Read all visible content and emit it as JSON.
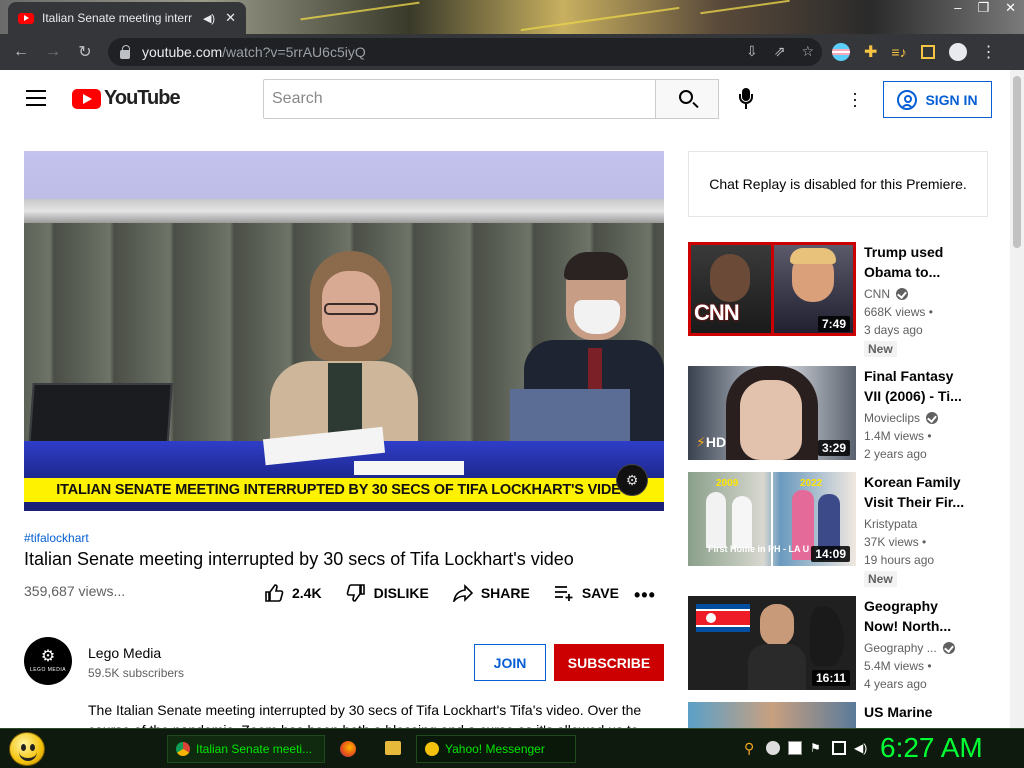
{
  "browser": {
    "tab_title": "Italian Senate meeting interr",
    "url_domain": "youtube.com",
    "url_path": "/watch?v=5rrAU6c5iyQ"
  },
  "masthead": {
    "logo_text": "YouTube",
    "search_placeholder": "Search",
    "signin_label": "SIGN IN"
  },
  "video": {
    "caption": "ITALIAN SENATE MEETING INTERRUPTED BY 30 SECS OF TIFA LOCKHART'S VIDEO",
    "hashtag": "#tifalockhart",
    "title": "Italian Senate meeting interrupted by 30 secs of Tifa Lockhart's video",
    "views": "359,687 views...",
    "actions": {
      "like_count": "2.4K",
      "dislike_label": "DISLIKE",
      "share_label": "SHARE",
      "save_label": "SAVE"
    },
    "channel": {
      "name": "Lego Media",
      "subscribers": "59.5K subscribers",
      "avatar_text": "LEGO MEDIA",
      "join_label": "JOIN",
      "subscribe_label": "SUBSCRIBE"
    },
    "description": "The Italian Senate meeting interrupted by 30 secs of Tifa Lockhart's Tifa's video. Over the course of the pandemic, Zoom has been both a blessing and a curse as it's allowed us to"
  },
  "chat": {
    "message": "Chat Replay is disabled for this Premiere."
  },
  "recommendations": [
    {
      "title": "Trump used Obama to...",
      "channel": "CNN",
      "verified": true,
      "views": "668K views •",
      "age": "3 days ago",
      "badge": "New",
      "duration": "7:49",
      "thumb_text": "CNN"
    },
    {
      "title": "Final Fantasy VII (2006) - Ti...",
      "channel": "Movieclips",
      "verified": true,
      "views": "1.4M views •",
      "age": "2 years ago",
      "badge": "",
      "duration": "3:29",
      "thumb_text": "HD"
    },
    {
      "title": "Korean Family Visit Their Fir...",
      "channel": "Kristypata",
      "verified": false,
      "views": "37K views •",
      "age": "19 hours ago",
      "badge": "New",
      "duration": "14:09",
      "thumb_text": "First Home in PH - LA U",
      "thumb_year1": "2009",
      "thumb_year2": "2022"
    },
    {
      "title": "Geography Now! North...",
      "channel": "Geography ...",
      "verified": true,
      "views": "5.4M views •",
      "age": "4 years ago",
      "badge": "",
      "duration": "16:11",
      "thumb_text": ""
    },
    {
      "title": "US Marine",
      "channel": "",
      "verified": false,
      "views": "",
      "age": "",
      "badge": "",
      "duration": "",
      "thumb_text": ""
    }
  ],
  "taskbar": {
    "chrome_task": "Italian Senate meeti...",
    "yahoo_task": "Yahoo! Messenger",
    "clock": "6:27 AM"
  },
  "colors": {
    "yt_red": "#ff0000",
    "link_blue": "#065fd4",
    "subscribe_red": "#cc0000",
    "caption_yellow": "#fff200",
    "clock_green": "#00ff33"
  }
}
